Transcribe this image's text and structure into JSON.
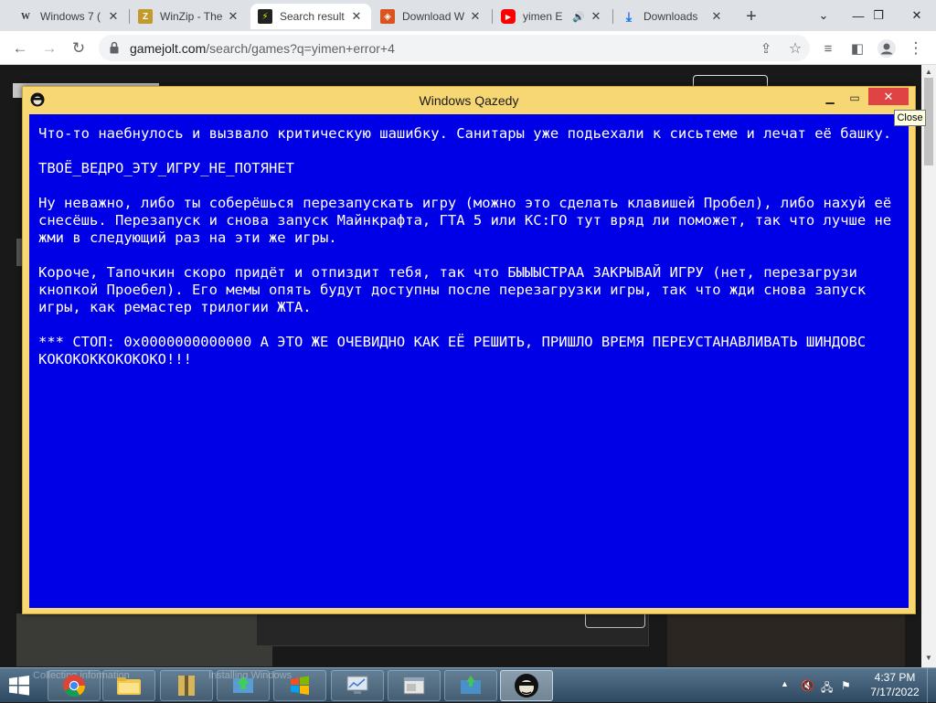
{
  "browser": {
    "tabs": [
      {
        "title": "Windows 7 (",
        "icon": "wiki-icon"
      },
      {
        "title": "WinZip - The",
        "icon": "winzip-icon"
      },
      {
        "title": "Search result",
        "icon": "gamejolt-icon"
      },
      {
        "title": "Download W",
        "icon": "shield-icon"
      },
      {
        "title": "yimen E",
        "icon": "youtube-icon"
      },
      {
        "title": "Downloads",
        "icon": "download-icon"
      }
    ],
    "url_host": "gamejolt.com",
    "url_path": "/search/games?q=yimen+error+4"
  },
  "dialog": {
    "title": "Windows Qazedy",
    "close_tooltip": "Close",
    "paragraphs": [
      "Что-то наебнулось и вызвало критическую шашибку. Санитары уже подьехали к сисьтеме и лечат её башку.",
      "ТВОЁ_ВЕДРО_ЭТУ_ИГРУ_НЕ_ПОТЯНЕТ",
      "Ну неважно, либо ты соберёшься перезапускать игру (можно это сделать клавишей Пробел), либо нахуй её снесёшь. Перезапуск и снова запуск Майнкрафта, ГТА 5 или КС:ГО тут вряд ли поможет, так что лучше не жми в следующий раз на эти же игры.",
      "Короче, Тапочкин скоро придёт и отпиздит тебя, так что БЫЫЫСТРАА ЗАКРЫВАЙ ИГРУ (нет, перезагрузи кнопкой Проебел). Его мемы опять будут доступны после перезагрузки игры, так что жди снова запуск игры, как ремастер трилогии ЖТА.",
      "*** СТОП: 0x0000000000000 А ЭТО ЖЕ ОЧЕВИДНО КАК ЕЁ РЕШИТЬ, ПРИШЛО ВРЕМЯ ПЕРЕУСТАНАВЛИВАТЬ ШИНДОВС КОКОКОККОКОКОКО!!!"
    ]
  },
  "taskbar": {
    "ghost_left": "Collecting information",
    "ghost_right": "Installing Windows",
    "time": "4:37 PM",
    "date": "7/17/2022"
  },
  "colors": {
    "bsod_blue": "#0000e6",
    "dialog_frame": "#f7d774",
    "close_red": "#e04343"
  }
}
